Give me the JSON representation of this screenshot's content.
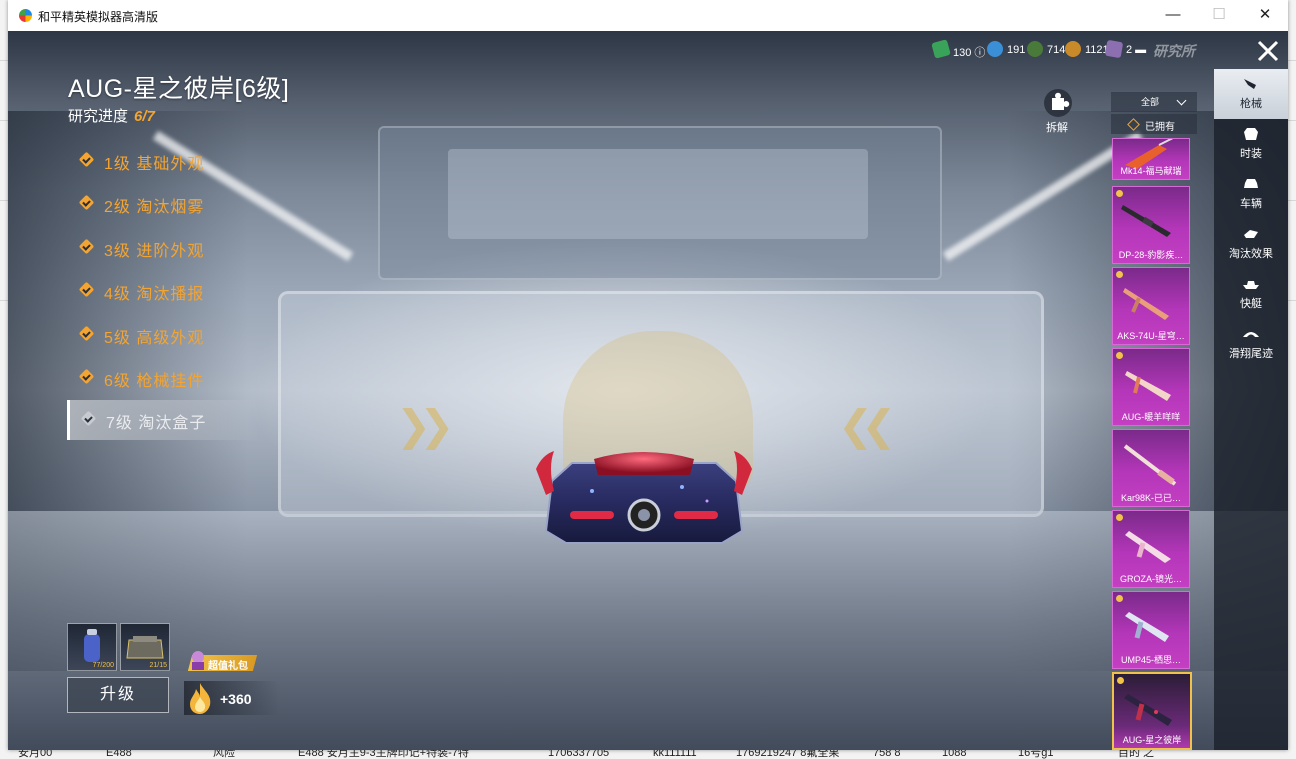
{
  "window": {
    "title": "和平精英模拟器高清版"
  },
  "weapon": {
    "title": "AUG-星之彼岸[6级]",
    "progress_label": "研究进度",
    "progress_value": "6/7"
  },
  "levels": [
    {
      "label": "1级 基础外观",
      "state": "unlocked"
    },
    {
      "label": "2级 淘汰烟雾",
      "state": "unlocked"
    },
    {
      "label": "3级 进阶外观",
      "state": "unlocked"
    },
    {
      "label": "4级 淘汰播报",
      "state": "unlocked"
    },
    {
      "label": "5级 高级外观",
      "state": "unlocked"
    },
    {
      "label": "6级 枪械挂件",
      "state": "unlocked"
    },
    {
      "label": "7级 淘汰盒子",
      "state": "current"
    }
  ],
  "materials": [
    {
      "name": "upgrade-material",
      "count": "77/200"
    },
    {
      "name": "crate-material",
      "count": "21/15"
    }
  ],
  "upgrade": {
    "label": "升级"
  },
  "gift": {
    "label": "超值礼包"
  },
  "heat": {
    "value": "+360"
  },
  "currencies": [
    {
      "name": "ticket",
      "value": "130",
      "color": "#3aa35a"
    },
    {
      "name": "coin",
      "value": "191",
      "color": "#3b8fd6"
    },
    {
      "name": "token",
      "value": "714",
      "color": "#4a7a3a"
    },
    {
      "name": "gold",
      "value": "1121",
      "color": "#c98a2a"
    },
    {
      "name": "voucher",
      "value": "2",
      "color": "#8c6fb0"
    }
  ],
  "lab": {
    "label": "研究所"
  },
  "disassemble": {
    "label": "拆解"
  },
  "filter": {
    "all": "全部",
    "owned": "已拥有"
  },
  "skins": [
    {
      "name": "Mk14-福马献瑞",
      "selected": false
    },
    {
      "name": "DP-28-豹影疾…",
      "selected": false
    },
    {
      "name": "AKS-74U-星穹…",
      "selected": false
    },
    {
      "name": "AUG-暖羊咩咩",
      "selected": false
    },
    {
      "name": "Kar98K-已已…",
      "selected": false
    },
    {
      "name": "GROZA-镜光…",
      "selected": false
    },
    {
      "name": "UMP45-栖思…",
      "selected": false
    },
    {
      "name": "AUG-星之彼岸",
      "selected": true
    }
  ],
  "categories": [
    {
      "label": "枪械",
      "icon": "gun-icon",
      "active": true
    },
    {
      "label": "时装",
      "icon": "outfit-icon",
      "active": false
    },
    {
      "label": "车辆",
      "icon": "car-icon",
      "active": false
    },
    {
      "label": "淘汰效果",
      "icon": "elimination-effect-icon",
      "active": false
    },
    {
      "label": "快艇",
      "icon": "boat-icon",
      "active": false
    },
    {
      "label": "滑翔尾迹",
      "icon": "glider-trail-icon",
      "active": false
    }
  ],
  "background_sheet": {
    "bottom_row": [
      "安月00",
      "E488",
      "风险",
      "E488 安月主9-3主牌印记+特装-7特",
      "1706337705",
      "kk111111",
      "1769219247 8氟全果",
      "758 8",
      "1088",
      "16号g1",
      "目的 之"
    ]
  }
}
